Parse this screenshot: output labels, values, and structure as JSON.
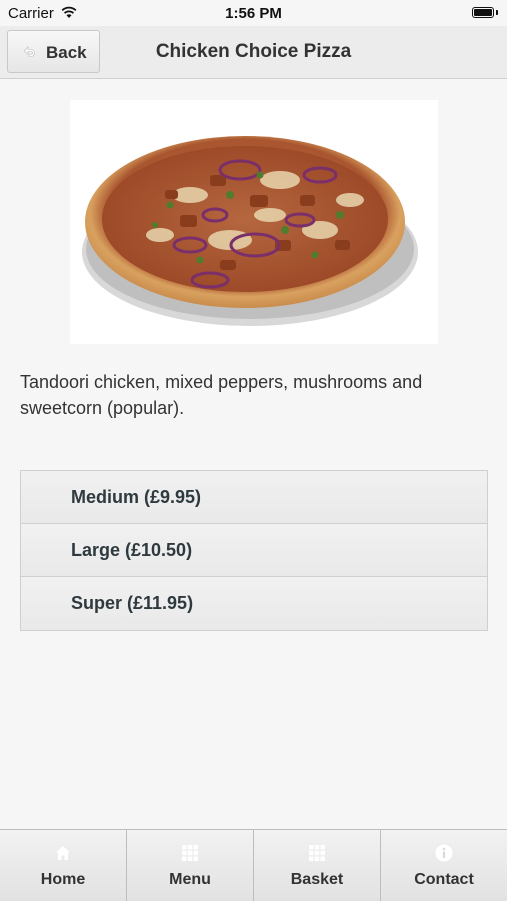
{
  "status_bar": {
    "carrier": "Carrier",
    "time": "1:56 PM"
  },
  "nav": {
    "back_label": "Back",
    "title": "Chicken Choice Pizza"
  },
  "product": {
    "image_icon": "pizza-image",
    "description": "Tandoori chicken, mixed peppers, mushrooms and sweetcorn (popular)."
  },
  "sizes": [
    {
      "label": "Medium (£9.95)"
    },
    {
      "label": "Large (£10.50)"
    },
    {
      "label": "Super (£11.95)"
    }
  ],
  "tabs": [
    {
      "label": "Home",
      "icon": "home-icon"
    },
    {
      "label": "Menu",
      "icon": "grid-icon"
    },
    {
      "label": "Basket",
      "icon": "grid-icon"
    },
    {
      "label": "Contact",
      "icon": "info-icon"
    }
  ],
  "colors": {
    "tab_icon": "#ffffff",
    "accent_text": "#2f3a3f"
  }
}
